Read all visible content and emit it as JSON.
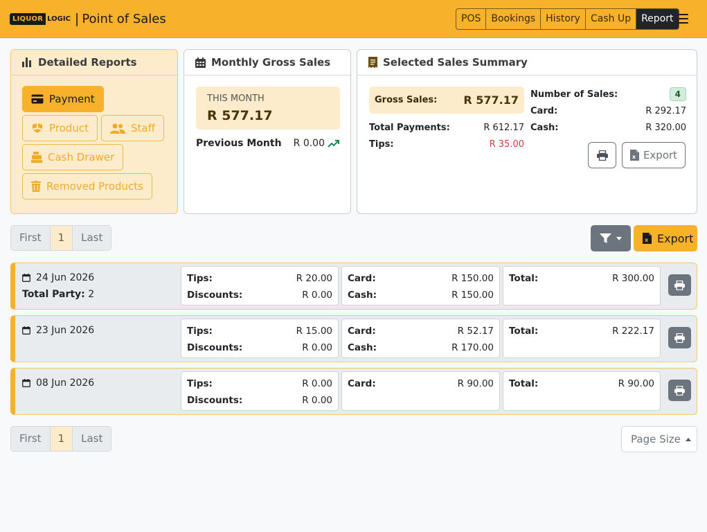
{
  "header": {
    "logo_part1": "LIQUOR",
    "logo_part2": "LOGIC",
    "separator": "|",
    "title": "Point of Sales",
    "nav": [
      "POS",
      "Bookings",
      "History",
      "Cash Up",
      "Report"
    ],
    "active_nav": "Report"
  },
  "reports": {
    "title": "Detailed Reports",
    "buttons": {
      "payment": "Payment",
      "product": "Product",
      "staff": "Staff",
      "cash_drawer": "Cash Drawer",
      "removed_products": "Removed Products"
    },
    "active": "Payment"
  },
  "monthly": {
    "title": "Monthly Gross Sales",
    "this_month_label": "THIS MONTH",
    "this_month_value": "R 577.17",
    "previous_label": "Previous Month",
    "previous_value": "R 0.00"
  },
  "summary": {
    "title": "Selected Sales Summary",
    "gross_label": "Gross Sales:",
    "gross_value": "R 577.17",
    "total_payments_label": "Total Payments:",
    "total_payments_value": "R 612.17",
    "tips_label": "Tips:",
    "tips_value": "R 35.00",
    "num_sales_label": "Number of Sales:",
    "num_sales_value": "4",
    "card_label": "Card:",
    "card_value": "R 292.17",
    "cash_label": "Cash:",
    "cash_value": "R 320.00",
    "export_label": "Export"
  },
  "pagination": {
    "first": "First",
    "page": "1",
    "last": "Last"
  },
  "toolbar": {
    "export_label": "Export"
  },
  "labels": {
    "tips": "Tips:",
    "discounts": "Discounts:",
    "card": "Card:",
    "cash": "Cash:",
    "total": "Total:",
    "total_party": "Total Party:"
  },
  "rows": [
    {
      "date": "24 Jun 2026",
      "party": "2",
      "tips": "R 20.00",
      "discounts": "R 0.00",
      "card": "R 150.00",
      "cash": "R 150.00",
      "total": "R 300.00"
    },
    {
      "date": "23 Jun 2026",
      "tips": "R 15.00",
      "discounts": "R 0.00",
      "card": "R 52.17",
      "cash": "R 170.00",
      "total": "R 222.17"
    },
    {
      "date": "08 Jun 2026",
      "tips": "R 0.00",
      "discounts": "R 0.00",
      "card": "R 90.00",
      "total": "R 90.00"
    }
  ],
  "page_size_label": "Page Size",
  "colors": {
    "brand": "#f8b12a",
    "accent_light": "#fdeccc",
    "tips_red": "#dc3545",
    "trend_green": "#198754",
    "secondary": "#6c757d",
    "dark": "#212529"
  },
  "icons": {
    "menu": "hamburger-icon",
    "reports": "bar-chart-icon",
    "calendar": "calendar-icon",
    "receipt": "receipt-icon",
    "payment": "credit-card-icon",
    "product": "boxes-icon",
    "staff": "users-icon",
    "cash_drawer": "cash-register-icon",
    "removed": "trash-icon",
    "trend": "trend-up-icon",
    "print": "printer-icon",
    "excel": "excel-file-icon",
    "filter": "filter-icon"
  }
}
